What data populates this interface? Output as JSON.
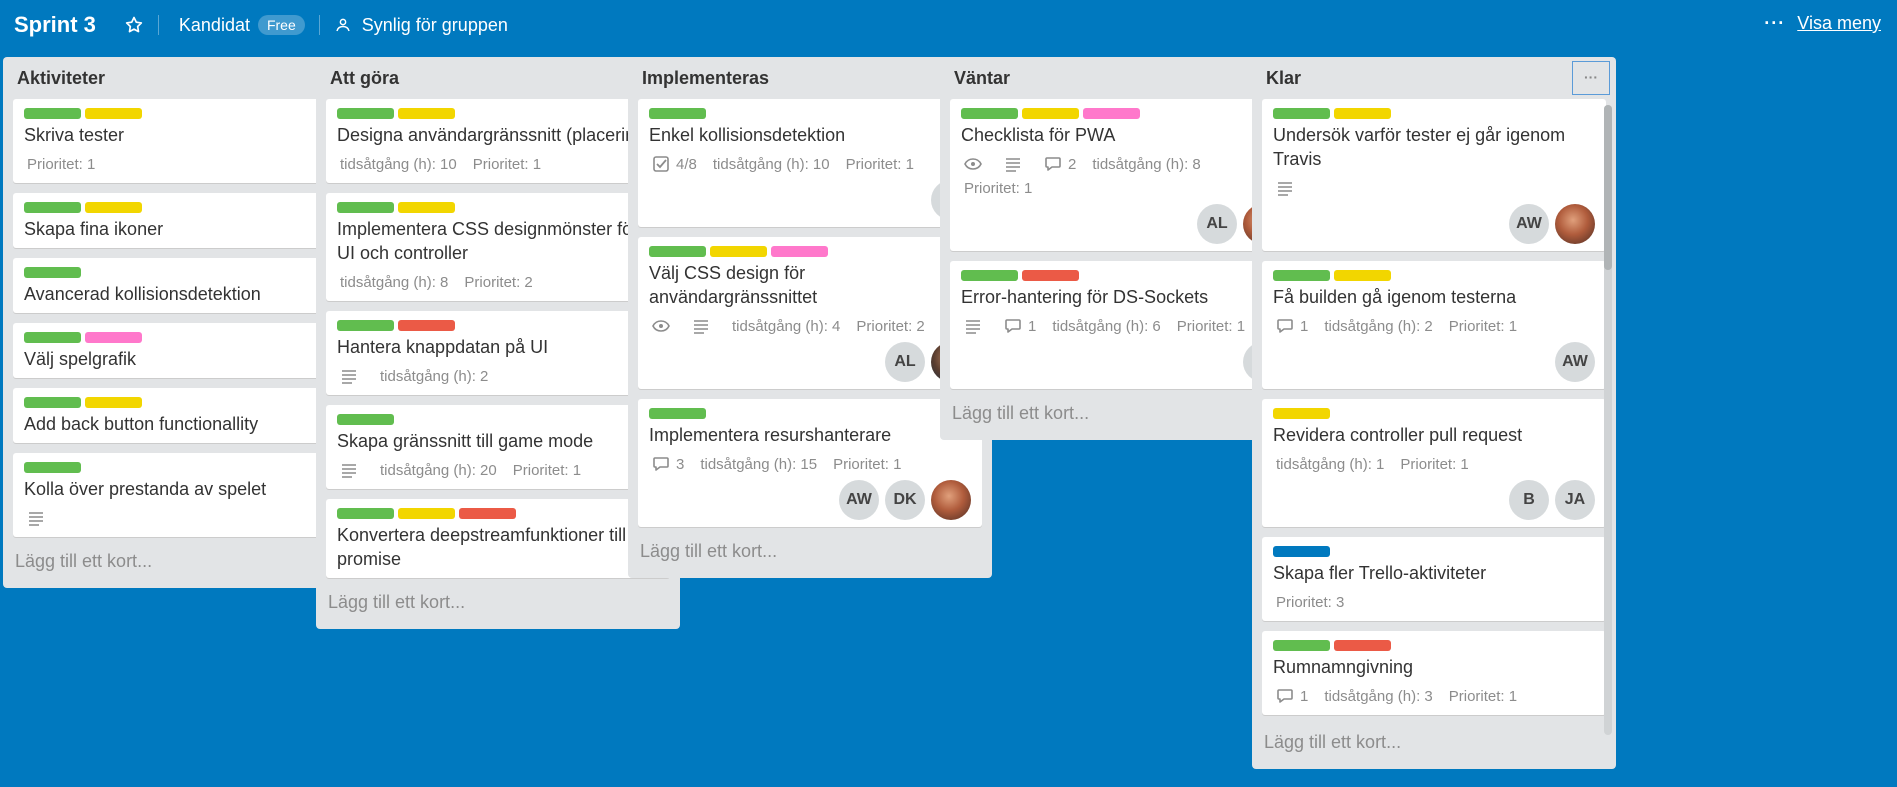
{
  "header": {
    "title": "Sprint 3",
    "team": "Kandidat",
    "team_badge": "Free",
    "visibility": "Synlig för gruppen",
    "menu_dots": "···",
    "menu_label": "Visa meny"
  },
  "add_card_label": "Lägg till ett kort...",
  "lists": [
    {
      "title": "Aktiviteter",
      "cards": [
        {
          "labels": [
            "green",
            "yellow"
          ],
          "title": "Skriva tester",
          "badges": [
            {
              "type": "text",
              "text": "Prioritet: 1"
            }
          ],
          "members": []
        },
        {
          "labels": [
            "green",
            "yellow"
          ],
          "title": "Skapa fina ikoner",
          "badges": [],
          "members": []
        },
        {
          "labels": [
            "green"
          ],
          "title": "Avancerad kollisionsdetektion",
          "badges": [],
          "members": []
        },
        {
          "labels": [
            "green",
            "pink"
          ],
          "title": "Välj spelgrafik",
          "badges": [],
          "members": []
        },
        {
          "labels": [
            "green",
            "yellow"
          ],
          "title": "Add back button functionallity",
          "badges": [],
          "members": []
        },
        {
          "labels": [
            "green"
          ],
          "title": "Kolla över prestanda av spelet",
          "badges": [
            {
              "type": "description",
              "text": ""
            }
          ],
          "members": []
        }
      ]
    },
    {
      "title": "Att göra",
      "cards": [
        {
          "labels": [
            "green",
            "yellow"
          ],
          "title": "Designa användargränssnitt (placering)",
          "badges": [
            {
              "type": "text",
              "text": "tidsåtgång (h): 10"
            },
            {
              "type": "text",
              "text": "Prioritet: 1"
            }
          ],
          "members": []
        },
        {
          "labels": [
            "green",
            "yellow"
          ],
          "title": "Implementera CSS designmönster för UI och controller",
          "badges": [
            {
              "type": "text",
              "text": "tidsåtgång (h): 8"
            },
            {
              "type": "text",
              "text": "Prioritet: 2"
            }
          ],
          "members": []
        },
        {
          "labels": [
            "green",
            "red"
          ],
          "title": "Hantera knappdatan på UI",
          "badges": [
            {
              "type": "description",
              "text": ""
            },
            {
              "type": "text",
              "text": "tidsåtgång (h): 2"
            }
          ],
          "members": []
        },
        {
          "labels": [
            "green"
          ],
          "title": "Skapa gränssnitt till game mode",
          "badges": [
            {
              "type": "description",
              "text": ""
            },
            {
              "type": "text",
              "text": "tidsåtgång (h): 20"
            },
            {
              "type": "text",
              "text": "Prioritet: 1"
            }
          ],
          "members": []
        },
        {
          "labels": [
            "green",
            "yellow",
            "red"
          ],
          "title": "Konvertera deepstreamfunktioner till promise",
          "badges": [],
          "members": []
        }
      ]
    },
    {
      "title": "Implementeras",
      "cards": [
        {
          "labels": [
            "green"
          ],
          "title": "Enkel kollisionsdetektion",
          "badges": [
            {
              "type": "checklist",
              "text": "4/8"
            },
            {
              "type": "text",
              "text": "tidsåtgång (h): 10"
            },
            {
              "type": "text",
              "text": "Prioritet: 1"
            }
          ],
          "members": [
            {
              "initials": "B",
              "photo": ""
            }
          ]
        },
        {
          "labels": [
            "green",
            "yellow",
            "pink"
          ],
          "title": "Välj CSS design för användargränssnittet",
          "badges": [
            {
              "type": "watch",
              "text": ""
            },
            {
              "type": "description",
              "text": ""
            },
            {
              "type": "text",
              "text": "tidsåtgång (h): 4"
            },
            {
              "type": "text",
              "text": "Prioritet: 2"
            }
          ],
          "members": [
            {
              "initials": "AL",
              "photo": ""
            },
            {
              "initials": "",
              "photo": "photo2"
            }
          ]
        },
        {
          "labels": [
            "green"
          ],
          "title": "Implementera resurshanterare",
          "badges": [
            {
              "type": "comment",
              "text": "3"
            },
            {
              "type": "text",
              "text": "tidsåtgång (h): 15"
            },
            {
              "type": "text",
              "text": "Prioritet: 1"
            }
          ],
          "members": [
            {
              "initials": "AW",
              "photo": ""
            },
            {
              "initials": "DK",
              "photo": ""
            },
            {
              "initials": "",
              "photo": "photo"
            }
          ]
        }
      ]
    },
    {
      "title": "Väntar",
      "cards": [
        {
          "labels": [
            "green",
            "yellow",
            "pink"
          ],
          "title": "Checklista för PWA",
          "badges": [
            {
              "type": "watch",
              "text": ""
            },
            {
              "type": "description",
              "text": ""
            },
            {
              "type": "comment",
              "text": "2"
            },
            {
              "type": "text",
              "text": "tidsåtgång (h): 8"
            },
            {
              "type": "text",
              "text": "Prioritet: 1"
            }
          ],
          "members": [
            {
              "initials": "AL",
              "photo": ""
            },
            {
              "initials": "",
              "photo": "photo"
            }
          ]
        },
        {
          "labels": [
            "green",
            "red"
          ],
          "title": "Error-hantering för DS-Sockets",
          "badges": [
            {
              "type": "description",
              "text": ""
            },
            {
              "type": "comment",
              "text": "1"
            },
            {
              "type": "text",
              "text": "tidsåtgång (h): 6"
            },
            {
              "type": "text",
              "text": "Prioritet: 1"
            }
          ],
          "members": [
            {
              "initials": "TH",
              "photo": ""
            }
          ]
        }
      ]
    },
    {
      "title": "Klar",
      "cards": [
        {
          "labels": [
            "green",
            "yellow"
          ],
          "title": "Undersök varför tester ej går igenom Travis",
          "badges": [
            {
              "type": "description",
              "text": ""
            }
          ],
          "members": [
            {
              "initials": "AW",
              "photo": ""
            },
            {
              "initials": "",
              "photo": "photo"
            }
          ]
        },
        {
          "labels": [
            "green",
            "yellow"
          ],
          "title": "Få builden gå igenom testerna",
          "badges": [
            {
              "type": "comment",
              "text": "1"
            },
            {
              "type": "text",
              "text": "tidsåtgång (h): 2"
            },
            {
              "type": "text",
              "text": "Prioritet: 1"
            }
          ],
          "members": [
            {
              "initials": "AW",
              "photo": ""
            }
          ]
        },
        {
          "labels": [
            "yellow"
          ],
          "title": "Revidera controller pull request",
          "badges": [
            {
              "type": "text",
              "text": "tidsåtgång (h): 1"
            },
            {
              "type": "text",
              "text": "Prioritet: 1"
            }
          ],
          "members": [
            {
              "initials": "B",
              "photo": ""
            },
            {
              "initials": "JA",
              "photo": ""
            }
          ]
        },
        {
          "labels": [
            "blue"
          ],
          "title": "Skapa fler Trello-aktiviteter",
          "badges": [
            {
              "type": "text",
              "text": "Prioritet: 3"
            }
          ],
          "members": []
        },
        {
          "labels": [
            "green",
            "red"
          ],
          "title": "Rumnamngivning",
          "badges": [
            {
              "type": "comment",
              "text": "1"
            },
            {
              "type": "text",
              "text": "tidsåtgång (h): 3"
            },
            {
              "type": "text",
              "text": "Prioritet: 1"
            }
          ],
          "members": []
        }
      ]
    }
  ]
}
